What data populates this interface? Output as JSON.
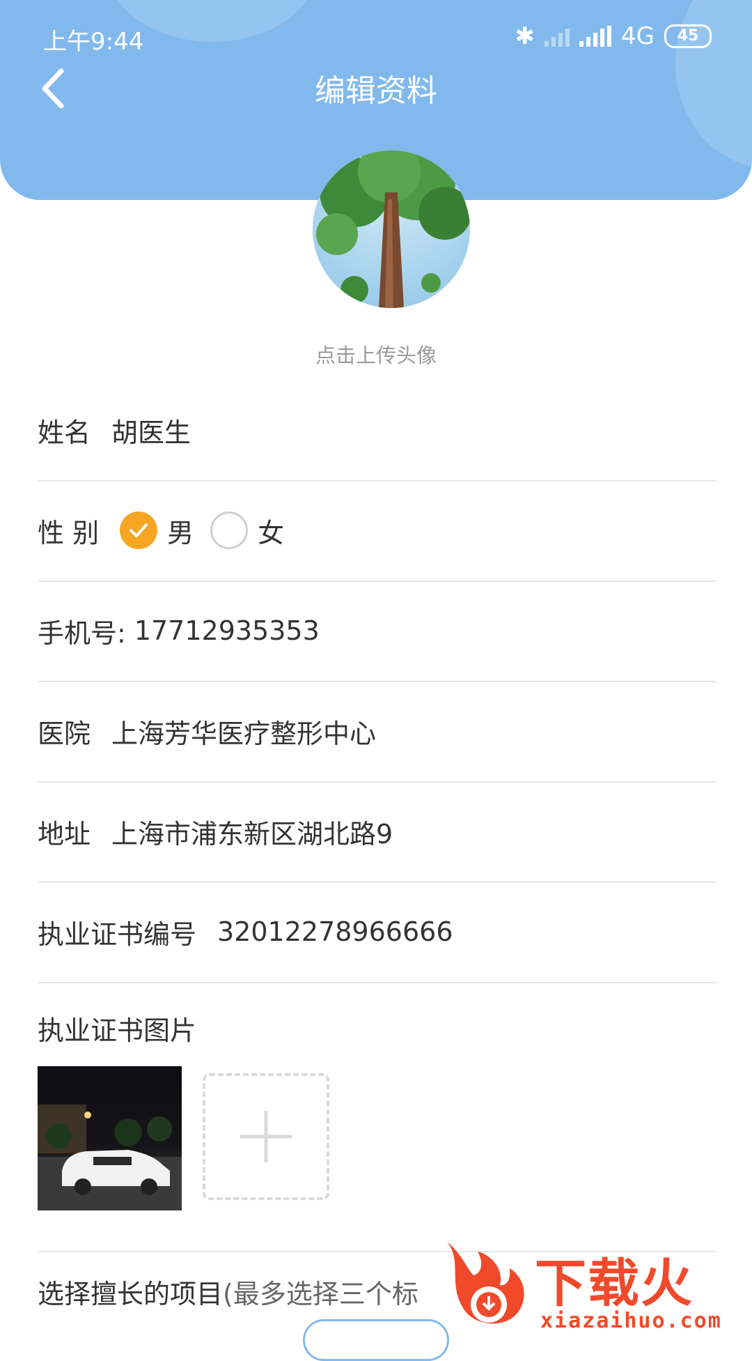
{
  "status_bar": {
    "time": "上午9:44",
    "network": "4G",
    "battery": "45"
  },
  "header": {
    "title": "编辑资料",
    "background_color": "#82b9ed"
  },
  "avatar": {
    "upload_hint": "点击上传头像"
  },
  "form": {
    "name": {
      "label": "姓名",
      "value": "胡医生"
    },
    "gender": {
      "label": "性 别",
      "options": [
        {
          "label": "男",
          "checked": true
        },
        {
          "label": "女",
          "checked": false
        }
      ],
      "accent_color": "#f6a623"
    },
    "phone": {
      "label": "手机号:",
      "value": "17712935353"
    },
    "hospital": {
      "label": "医院",
      "value": "上海芳华医疗整形中心"
    },
    "address": {
      "label": "地址",
      "value": "上海市浦东新区湖北路9"
    },
    "license_number": {
      "label": "执业证书编号",
      "value": "32012278966666"
    },
    "license_image": {
      "label": "执业证书图片"
    },
    "skills": {
      "label": "选择擅长的项目",
      "sub": "(最多选择三个标"
    }
  },
  "watermark": {
    "text": "下载火",
    "url": "xiazaihuo.com",
    "color": "#f04a2a"
  }
}
